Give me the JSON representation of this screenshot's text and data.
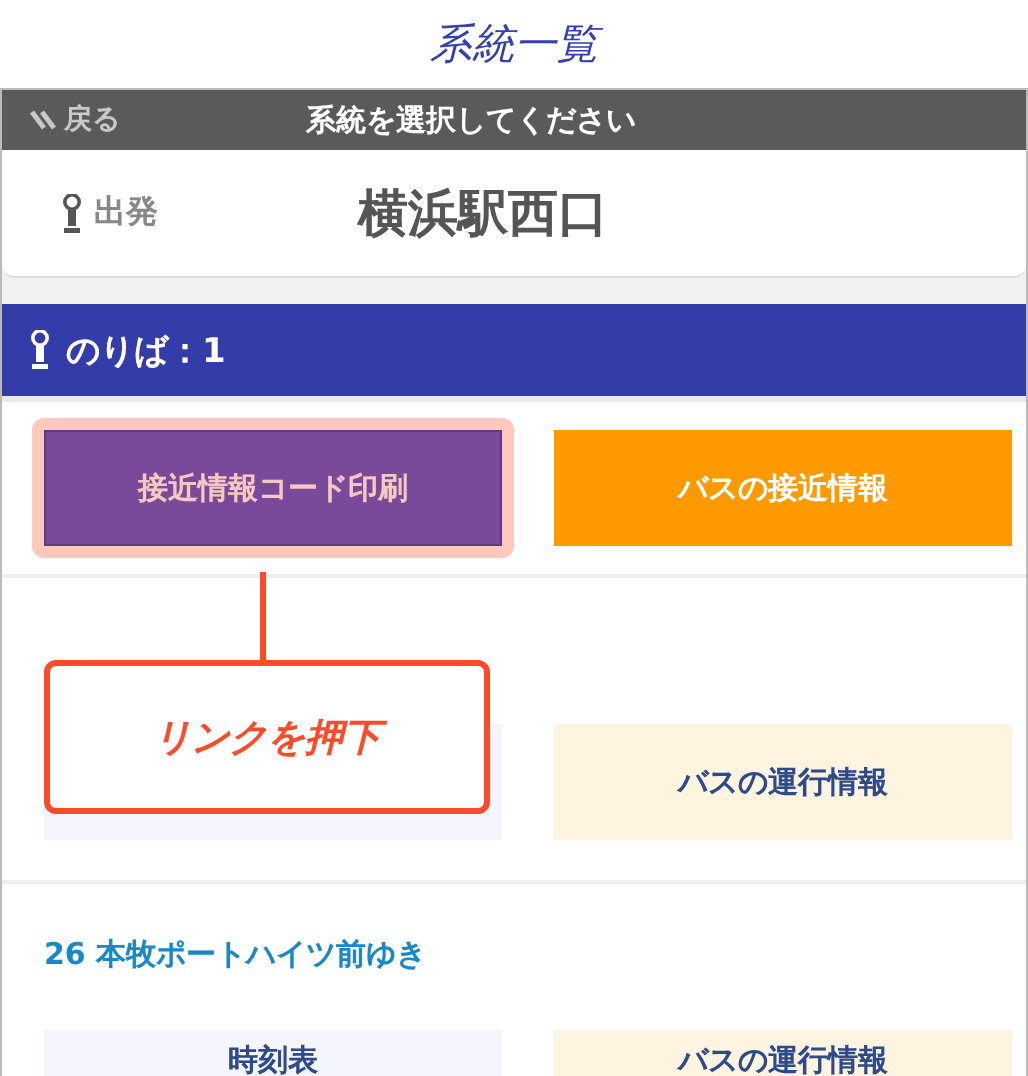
{
  "title": "系統一覧",
  "header": {
    "back": "戻る",
    "prompt": "系統を選択してください"
  },
  "origin": {
    "label": "出発",
    "stop": "横浜駅西口"
  },
  "platform": {
    "label": "のりば：1",
    "buttons": [
      {
        "label": "接近情報コード印刷",
        "kind": "print",
        "highlighted": true
      },
      {
        "label": "バスの接近情報",
        "kind": "approach",
        "highlighted": false
      }
    ]
  },
  "routes": [
    {
      "buttons": [
        {
          "kind": "timetable"
        },
        {
          "label": "バスの運行情報",
          "kind": "operation"
        }
      ]
    },
    {
      "name": "26 本牧ポートハイツ前ゆき",
      "buttons": [
        {
          "label": "時刻表",
          "kind": "timetable"
        },
        {
          "label": "バスの運行情報",
          "kind": "operation"
        }
      ]
    }
  ],
  "callout": {
    "text": "リンクを押下"
  }
}
